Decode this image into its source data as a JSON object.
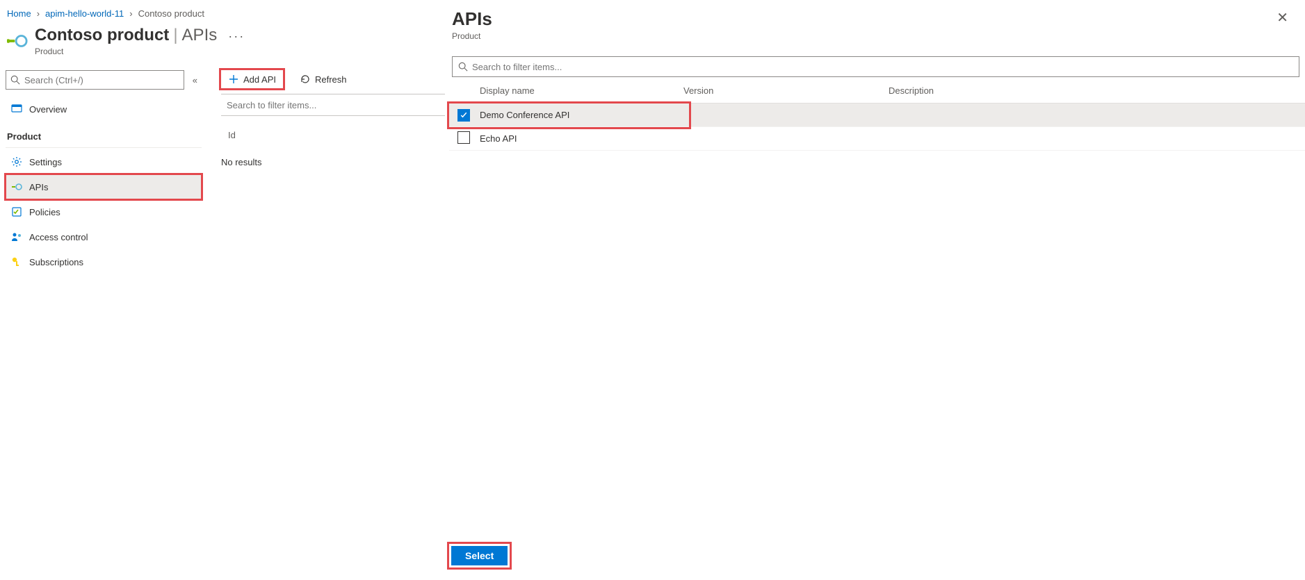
{
  "breadcrumb": {
    "items": [
      "Home",
      "apim-hello-world-11",
      "Contoso product"
    ]
  },
  "header": {
    "blade_name": "Contoso product",
    "section": "APIs",
    "subtitle": "Product"
  },
  "sidebar": {
    "search_placeholder": "Search (Ctrl+/)",
    "top_items": [
      {
        "label": "Overview",
        "icon": "overview"
      }
    ],
    "group_label": "Product",
    "product_items": [
      {
        "label": "Settings",
        "icon": "gear",
        "active": false
      },
      {
        "label": "APIs",
        "icon": "api",
        "active": true
      },
      {
        "label": "Policies",
        "icon": "policy",
        "active": false
      },
      {
        "label": "Access control",
        "icon": "access",
        "active": false
      },
      {
        "label": "Subscriptions",
        "icon": "key",
        "active": false
      }
    ]
  },
  "content": {
    "add_api_label": "Add API",
    "refresh_label": "Refresh",
    "filter_placeholder": "Search to filter items...",
    "id_column": "Id",
    "empty_text": "No results"
  },
  "panel": {
    "title": "APIs",
    "subtitle": "Product",
    "search_placeholder": "Search to filter items...",
    "columns": {
      "display_name": "Display name",
      "version": "Version",
      "description": "Description"
    },
    "rows": [
      {
        "name": "Demo Conference API",
        "checked": true,
        "highlighted": true
      },
      {
        "name": "Echo API",
        "checked": false,
        "highlighted": false
      }
    ],
    "select_label": "Select"
  }
}
